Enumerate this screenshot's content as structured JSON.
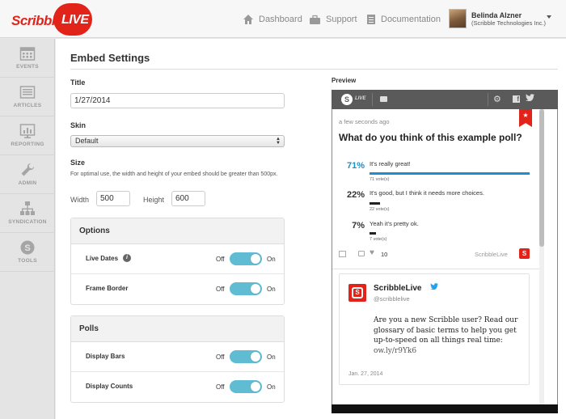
{
  "app": {
    "logo_text": "Scribble",
    "logo_badge": "LIVE"
  },
  "topnav": {
    "dashboard": "Dashboard",
    "support": "Support",
    "documentation": "Documentation"
  },
  "user": {
    "name": "Belinda Alzner",
    "org": "(Scribble Technologies Inc.)"
  },
  "sidebar": {
    "items": [
      {
        "label": "EVENTS",
        "icon": "calendar-icon"
      },
      {
        "label": "ARTICLES",
        "icon": "articles-icon"
      },
      {
        "label": "REPORTING",
        "icon": "reporting-icon"
      },
      {
        "label": "ADMIN",
        "icon": "wrench-icon"
      },
      {
        "label": "SYNDICATION",
        "icon": "syndication-icon"
      },
      {
        "label": "TOOLS",
        "icon": "tools-icon"
      }
    ]
  },
  "embed": {
    "page_title": "Embed Settings",
    "title_label": "Title",
    "title_value": "1/27/2014",
    "skin_label": "Skin",
    "skin_value": "Default",
    "size_label": "Size",
    "size_hint": "For optimal use, the width and height of your embed should be greater than 500px.",
    "width_label": "Width",
    "width_value": "500",
    "height_label": "Height",
    "height_value": "600"
  },
  "options_panel": {
    "title": "Options",
    "rows": [
      {
        "label": "Live Dates",
        "off": "Off",
        "on": "On",
        "state": "on",
        "info": "i"
      },
      {
        "label": "Frame Border",
        "off": "Off",
        "on": "On",
        "state": "on"
      }
    ]
  },
  "polls_panel": {
    "title": "Polls",
    "rows": [
      {
        "label": "Display Bars",
        "off": "Off",
        "on": "On",
        "state": "on"
      },
      {
        "label": "Display Counts",
        "off": "Off",
        "on": "On",
        "state": "on"
      }
    ]
  },
  "preview": {
    "label": "Preview",
    "bar": {
      "logo": "S",
      "live": "LIVE",
      "fb": "f"
    },
    "post_time": "a few seconds ago",
    "poll_question": "What do you think of this example poll?",
    "poll_answers": [
      {
        "pct": "71%",
        "text": "It's really great!",
        "votes": "71 vote(s)",
        "value": 71,
        "color": "#1a8fc9"
      },
      {
        "pct": "22%",
        "text": "It's good, but I think it needs more choices.",
        "votes": "22 vote(s)",
        "value": 22,
        "color": "#222222"
      },
      {
        "pct": "7%",
        "text": "Yeah it's pretty ok.",
        "votes": "7 vote(s)",
        "value": 7,
        "color": "#222222"
      }
    ],
    "likes": "10",
    "source": "ScribbleLive",
    "tweet": {
      "name": "ScribbleLive",
      "handle": "@scribblelive",
      "text": "Are you a new Scribble user? Read our glossary of basic terms to help you get up-to-speed on all things real time: ",
      "link": "ow.ly/r9Yk6",
      "date": "Jan. 27, 2014"
    }
  },
  "colors": {
    "brand_red": "#e2231a",
    "toggle_on": "#5fbcd3",
    "poll_accent": "#1a8fc9",
    "twitter_blue": "#1da1f2"
  }
}
